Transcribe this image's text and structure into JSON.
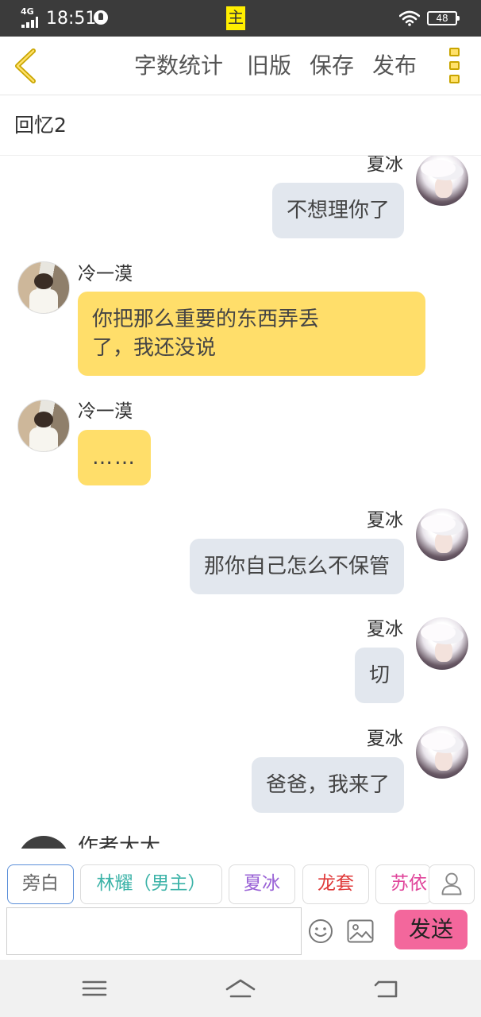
{
  "status_bar": {
    "network": "4G",
    "time": "18:51",
    "battery": "48"
  },
  "toolbar": {
    "actions": [
      "字数统计",
      "旧版",
      "保存",
      "发布"
    ]
  },
  "document": {
    "title": "回忆2"
  },
  "messages": [
    {
      "speaker": "夏冰",
      "text": "不想理你了",
      "side": "right",
      "avatar": "avatar-female"
    },
    {
      "speaker": "冷一漠",
      "text": "你把那么重要的东西弄丢\n了，我还没说",
      "side": "left",
      "avatar": "avatar-male"
    },
    {
      "speaker": "冷一漠",
      "text": "……",
      "side": "left",
      "avatar": "avatar-male"
    },
    {
      "speaker": "夏冰",
      "text": "那你自己怎么不保管",
      "side": "right",
      "avatar": "avatar-female"
    },
    {
      "speaker": "夏冰",
      "text": "切",
      "side": "right",
      "avatar": "avatar-female"
    },
    {
      "speaker": "夏冰",
      "text": "爸爸，我来了",
      "side": "right",
      "avatar": "avatar-female"
    },
    {
      "speaker": "作者大大",
      "text": "",
      "side": "left",
      "avatar": "avatar-author"
    }
  ],
  "roles": [
    {
      "label": "旁白",
      "color": "#666666",
      "active": true
    },
    {
      "label": "林耀（男主）",
      "color": "#3cb3a8",
      "active": false
    },
    {
      "label": "夏冰",
      "color": "#9a63d6",
      "active": false
    },
    {
      "label": "龙套",
      "color": "#e03a3a",
      "active": false
    },
    {
      "label": "苏依",
      "color": "#e0449a",
      "active": false
    }
  ],
  "lead_badge": "主",
  "composer": {
    "placeholder": "",
    "value": "",
    "send_label": "发送"
  },
  "colors": {
    "accent_yellow": "#ffde6a",
    "bubble_gray": "#e2e7ee",
    "send_pink": "#f3679c"
  }
}
